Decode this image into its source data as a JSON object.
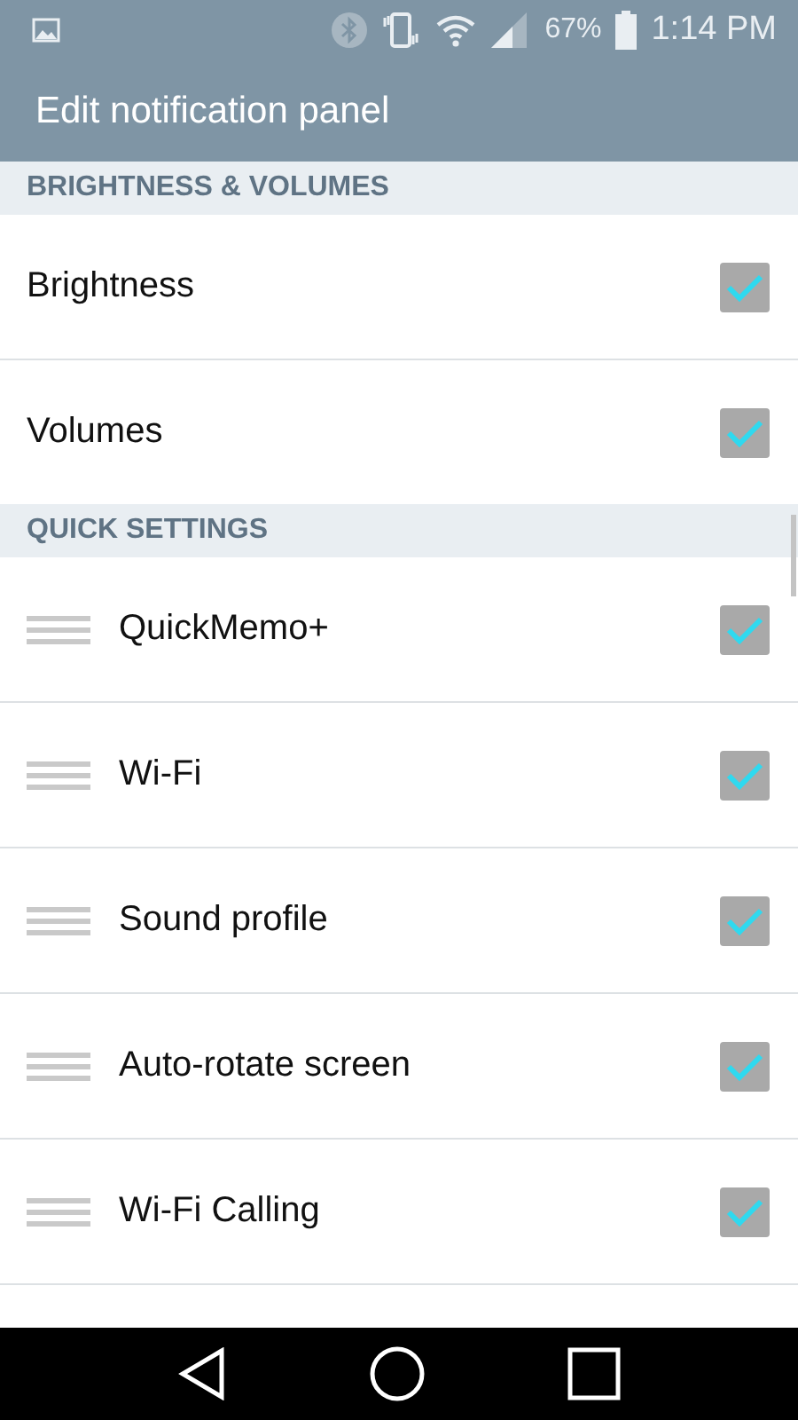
{
  "status_bar": {
    "battery_percent": "67%",
    "time": "1:14 PM"
  },
  "app_bar": {
    "title": "Edit notification panel"
  },
  "sections": [
    {
      "header": "BRIGHTNESS & VOLUMES",
      "items": [
        {
          "label": "Brightness",
          "kind": "fixed",
          "checked": true
        },
        {
          "label": "Volumes",
          "kind": "fixed",
          "checked": true
        }
      ]
    },
    {
      "header": "QUICK SETTINGS",
      "items": [
        {
          "label": "QuickMemo+",
          "kind": "draggable",
          "checked": true
        },
        {
          "label": "Wi-Fi",
          "kind": "draggable",
          "checked": true
        },
        {
          "label": "Sound profile",
          "kind": "draggable",
          "checked": true
        },
        {
          "label": "Auto-rotate screen",
          "kind": "draggable",
          "checked": true
        },
        {
          "label": "Wi-Fi Calling",
          "kind": "draggable",
          "checked": true
        }
      ]
    }
  ]
}
